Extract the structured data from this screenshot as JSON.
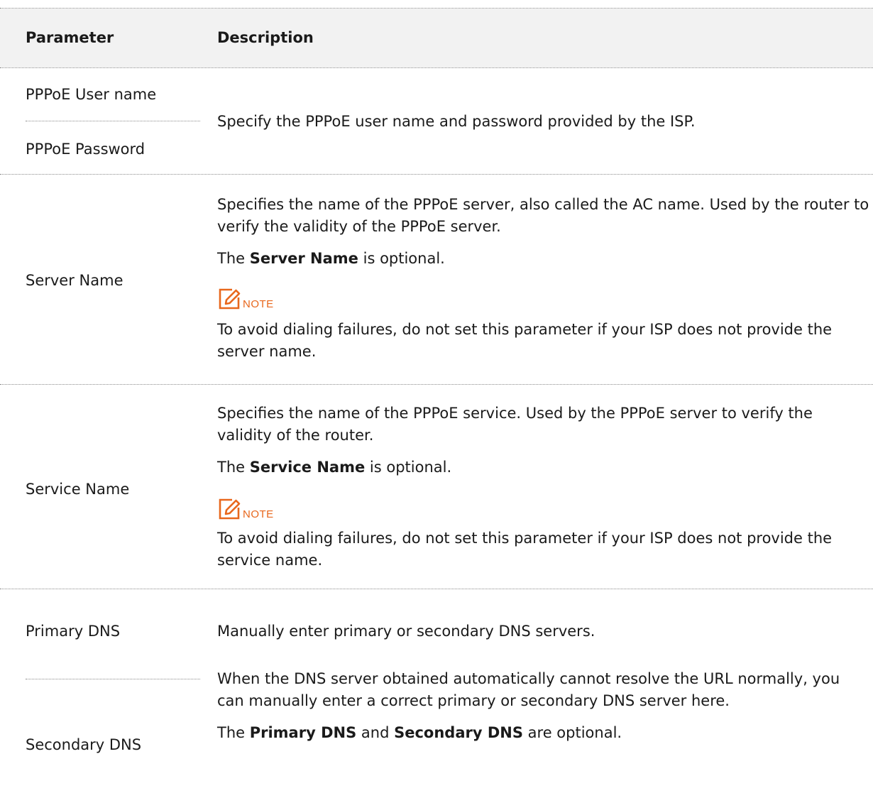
{
  "table": {
    "headers": {
      "parameter": "Parameter",
      "description": "Description"
    },
    "rows": {
      "pppoe": {
        "param_user": "PPPoE User name",
        "param_password": "PPPoE Password",
        "description": "Specify the PPPoE user name and password provided by the ISP."
      },
      "server_name": {
        "param": "Server Name",
        "description_1": "Specifies the name of the PPPoE server, also called the AC name. Used by the router to verify the validity of the PPPoE server.",
        "optional_pre": "The ",
        "optional_bold": "Server Name",
        "optional_post": " is optional.",
        "note_label": "NOTE",
        "note_text": "To avoid dialing failures, do not set this parameter if your ISP does not provide the server name."
      },
      "service_name": {
        "param": "Service Name",
        "description_1": "Specifies the name of the PPPoE service. Used by the PPPoE server to verify the validity of the router.",
        "optional_pre": "The ",
        "optional_bold": "Service Name",
        "optional_post": " is optional.",
        "note_label": "NOTE",
        "note_text": "To avoid dialing failures, do not set this parameter if your ISP does not provide the service name."
      },
      "dns": {
        "param_primary": "Primary DNS",
        "param_secondary": "Secondary DNS",
        "description_1": "Manually enter primary or secondary DNS servers.",
        "description_2": "When the DNS server obtained automatically cannot resolve the URL normally, you can manually enter a correct primary or secondary DNS server here.",
        "optional_pre": "The ",
        "optional_bold_1": "Primary DNS",
        "optional_mid": " and ",
        "optional_bold_2": "Secondary DNS",
        "optional_post": " are optional."
      }
    }
  },
  "colors": {
    "note_accent": "#e8671c",
    "header_bg": "#f2f2f2"
  },
  "icons": {
    "note": "note-pencil-icon"
  }
}
